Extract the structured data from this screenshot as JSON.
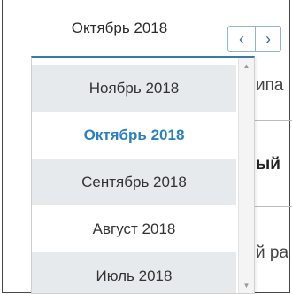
{
  "header": {
    "current_month": "Октябрь 2018",
    "prev_icon": "‹",
    "next_icon": "›"
  },
  "background": {
    "text_1": "ипа",
    "text_2": "ый",
    "text_3": "й ра"
  },
  "dropdown": {
    "options": [
      {
        "label": "Ноябрь 2018"
      },
      {
        "label": "Октябрь 2018"
      },
      {
        "label": "Сентябрь 2018"
      },
      {
        "label": "Август 2018"
      },
      {
        "label": "Июль 2018"
      }
    ],
    "selected_index": 1,
    "scroll_up_icon": "▲",
    "scroll_down_icon": "▼"
  },
  "colors": {
    "accent": "#2b80bd",
    "option_alt_bg": "#e7eaec",
    "nav_border": "#8fb4cf"
  }
}
